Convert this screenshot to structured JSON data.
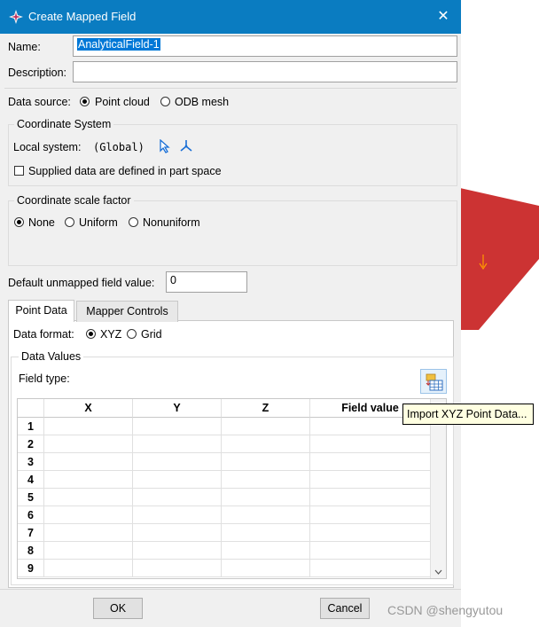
{
  "window": {
    "title": "Create Mapped Field",
    "close_glyph": "✕"
  },
  "name": {
    "label": "Name:",
    "value": "AnalyticalField-1"
  },
  "description": {
    "label": "Description:",
    "value": ""
  },
  "data_source": {
    "label": "Data source:",
    "options": [
      {
        "label": "Point cloud",
        "selected": true
      },
      {
        "label": "ODB mesh",
        "selected": false
      }
    ]
  },
  "coordinate_system": {
    "title": "Coordinate System",
    "local_label": "Local system:",
    "local_value": "(Global)",
    "supplied_label": "Supplied data are defined in part space",
    "supplied_checked": false
  },
  "scale_factor": {
    "title": "Coordinate scale factor",
    "options": [
      {
        "label": "None",
        "selected": true
      },
      {
        "label": "Uniform",
        "selected": false
      },
      {
        "label": "Nonuniform",
        "selected": false
      }
    ]
  },
  "default_value": {
    "label": "Default unmapped field value:",
    "value": "0"
  },
  "tabs": [
    {
      "label": "Point Data",
      "active": true
    },
    {
      "label": "Mapper Controls",
      "active": false
    }
  ],
  "data_format": {
    "label": "Data format:",
    "options": [
      {
        "label": "XYZ",
        "selected": true
      },
      {
        "label": "Grid",
        "selected": false
      }
    ]
  },
  "data_values": {
    "title": "Data Values",
    "field_type_label": "Field type:",
    "columns": [
      "X",
      "Y",
      "Z",
      "Field value"
    ],
    "rows": [
      "1",
      "2",
      "3",
      "4",
      "5",
      "6",
      "7",
      "8",
      "9"
    ]
  },
  "tooltip": "Import XYZ Point Data...",
  "buttons": {
    "ok": "OK",
    "cancel": "Cancel"
  },
  "watermark": "CSDN @shengyutou",
  "colors": {
    "titlebar": "#0a7cc1",
    "bg_shape": "#d13438",
    "selection": "#0078d7"
  }
}
